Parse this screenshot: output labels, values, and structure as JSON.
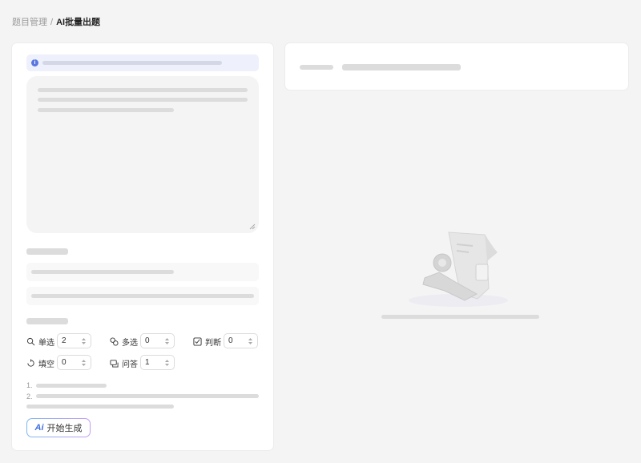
{
  "breadcrumb": {
    "parent": "题目管理",
    "separator": "/",
    "current": "AI批量出题"
  },
  "info": {
    "icon": "i"
  },
  "question_types": [
    {
      "label": "单选",
      "value": "2",
      "icon": "single-choice-icon"
    },
    {
      "label": "多选",
      "value": "0",
      "icon": "multi-choice-icon"
    },
    {
      "label": "判断",
      "value": "0",
      "icon": "judge-icon"
    },
    {
      "label": "填空",
      "value": "0",
      "icon": "fill-blank-icon"
    },
    {
      "label": "问答",
      "value": "1",
      "icon": "qa-icon"
    }
  ],
  "notes": {
    "n1": "1.",
    "n2": "2."
  },
  "actions": {
    "start_ai": "Ai",
    "start_label": "开始生成"
  },
  "colors": {
    "accent": "#5b76e0",
    "ai_blue": "#3f6fe0",
    "gradient_end": "#c59cf0"
  }
}
